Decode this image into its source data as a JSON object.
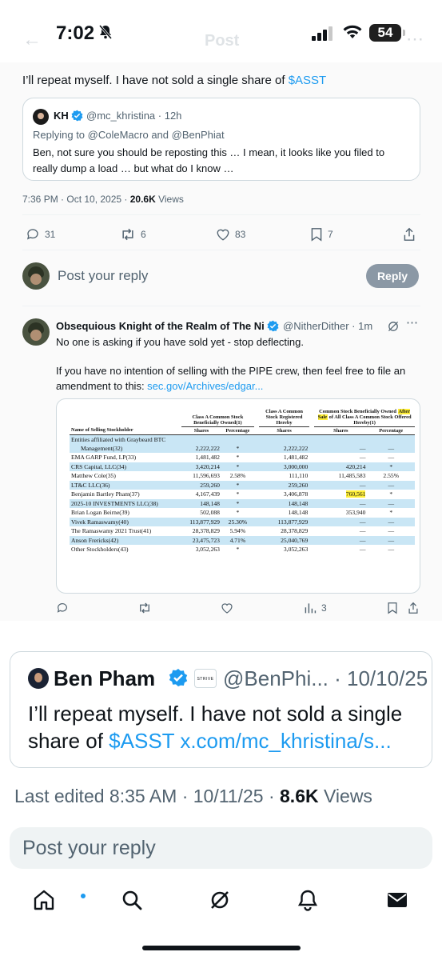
{
  "status_bar": {
    "time": "7:02",
    "battery": "54"
  },
  "header": {
    "title": "Post"
  },
  "quoted_tweet": {
    "text_prefix": "I’ll repeat myself. I have not sold a single share of ",
    "cashtag": "$ASST",
    "inner_quote": {
      "name": "KH",
      "handle_time": "@mc_khristina · 12h",
      "replying_prefix": "Replying to ",
      "replying_to": "@ColeMacro and @BenPhiat",
      "body": "Ben, not sure you should be reposting this … I mean, it looks like you filed to really dump a load … but what do I know …"
    },
    "timestamp": "7:36 PM · Oct 10, 2025 · ",
    "views_count": "20.6K",
    "views_label": " Views",
    "actions": {
      "replies": "31",
      "reposts": "6",
      "likes": "83",
      "bookmarks": "7"
    },
    "reply_placeholder": "Post your reply",
    "reply_button": "Reply"
  },
  "reply": {
    "name": "Obsequious Knight of the Realm of The Ni",
    "handle_time": "@NitherDither · 1m",
    "line1": "No one is asking if you have sold yet - stop deflecting.",
    "line2": "If you have no intention of selling with the PIPE crew, then feel free to file an amendment to this: ",
    "link": "sec.gov/Archives/edgar...",
    "views": "3"
  },
  "filing_table": {
    "header_group1": "Class A Common Stock Beneficially Owned(1)",
    "header_group2": "Class A Common Stock Registered Hereby",
    "header_group3_a": "Common Stock Beneficially Owned ",
    "header_group3_hl": "After Sale",
    "header_group3_b": " of All Class A Common Stock Offered Hereby(1)",
    "col_name": "Name of Selling Stockholder",
    "col_shares": "Shares",
    "col_pct": "Percentage",
    "rows": [
      {
        "name": "Entities affiliated with Graybeard BTC",
        "shares": "",
        "pct": "",
        "reg": "",
        "after": "",
        "after_pct": ""
      },
      {
        "name": "Management(32)",
        "shares": "2,222,222",
        "pct": "*",
        "reg": "2,222,222",
        "after": "—",
        "after_pct": "—"
      },
      {
        "name": "EMA GARP Fund, LP(33)",
        "shares": "1,481,482",
        "pct": "*",
        "reg": "1,481,482",
        "after": "—",
        "after_pct": "—"
      },
      {
        "name": "CRS Capital, LLC(34)",
        "shares": "3,420,214",
        "pct": "*",
        "reg": "3,000,000",
        "after": "420,214",
        "after_pct": "*"
      },
      {
        "name": "Matthew Cole(35)",
        "shares": "11,596,693",
        "pct": "2.58%",
        "reg": "111,110",
        "after": "11,485,583",
        "after_pct": "2.55%"
      },
      {
        "name": "LT&C LLC(36)",
        "shares": "259,260",
        "pct": "*",
        "reg": "259,260",
        "after": "—",
        "after_pct": "—"
      },
      {
        "name": "Benjamin Bartley Pham(37)",
        "shares": "4,167,439",
        "pct": "*",
        "reg": "3,406,878",
        "after": "760,561",
        "after_pct": "*"
      },
      {
        "name": "2025-10 INVESTMENTS LLC(38)",
        "shares": "148,148",
        "pct": "*",
        "reg": "148,148",
        "after": "—",
        "after_pct": "—"
      },
      {
        "name": "Brian Logan Beirne(39)",
        "shares": "502,088",
        "pct": "*",
        "reg": "148,148",
        "after": "353,940",
        "after_pct": "*"
      },
      {
        "name": "Vivek Ramaswamy(40)",
        "shares": "113,877,929",
        "pct": "25.30%",
        "reg": "113,877,929",
        "after": "—",
        "after_pct": "—"
      },
      {
        "name": "The Ramaswamy 2021 Trust(41)",
        "shares": "28,378,829",
        "pct": "5.94%",
        "reg": "28,378,829",
        "after": "—",
        "after_pct": "—"
      },
      {
        "name": "Anson Frericks(42)",
        "shares": "23,475,723",
        "pct": "4.71%",
        "reg": "25,040,769",
        "after": "—",
        "after_pct": "—"
      },
      {
        "name": "Other Stockholders(43)",
        "shares": "3,052,263",
        "pct": "*",
        "reg": "3,052,263",
        "after": "—",
        "after_pct": "—"
      }
    ]
  },
  "main_tweet": {
    "name": "Ben Pham",
    "badge": "STRIVE",
    "handle_time": "@BenPhi... · 10/10/25",
    "text_prefix": "I’ll repeat myself. I have not sold a single share of ",
    "cashtag": "$ASST",
    "link": "x.com/mc_khristina/s...",
    "edited": "Last edited 8:35 AM · 10/11/25 · ",
    "views_count": "8.6K",
    "views_label": " Views"
  },
  "composer": {
    "placeholder": "Post your reply"
  },
  "colors": {
    "accent": "#1d9bf0",
    "text": "#0f1419",
    "muted": "#536471",
    "table_highlight": "#c9e6f5",
    "marker": "#ffef3a"
  }
}
